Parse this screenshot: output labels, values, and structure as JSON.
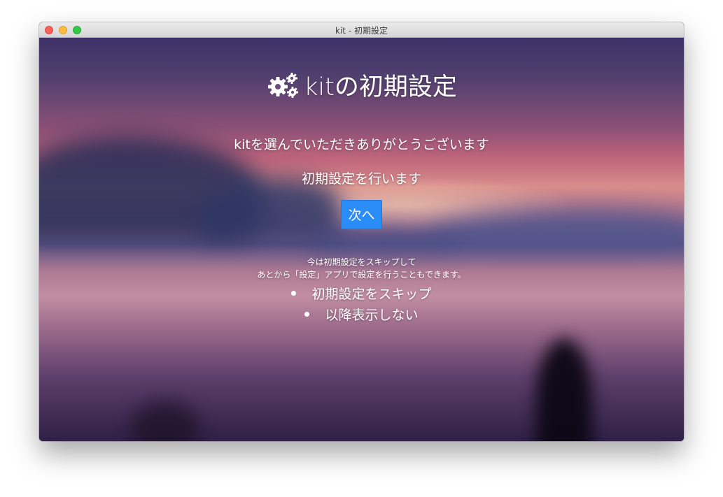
{
  "window": {
    "title": "kit - 初期設定"
  },
  "header": {
    "icon": "gears-icon",
    "title": "kitの初期設定"
  },
  "main": {
    "thanks": "kitを選んでいただきありがとうございます",
    "setup_text": "初期設定を行います",
    "next_button": "次へ",
    "note_line1": "今は初期設定をスキップして",
    "note_line2": "あとから「設定」アプリで設定を行うこともできます。",
    "options": [
      {
        "label": "初期設定をスキップ"
      },
      {
        "label": "以降表示しない"
      }
    ]
  },
  "colors": {
    "accent": "#2a8cf7",
    "close": "#fc605c",
    "minimize": "#fdbc40",
    "zoom": "#34c84a"
  }
}
